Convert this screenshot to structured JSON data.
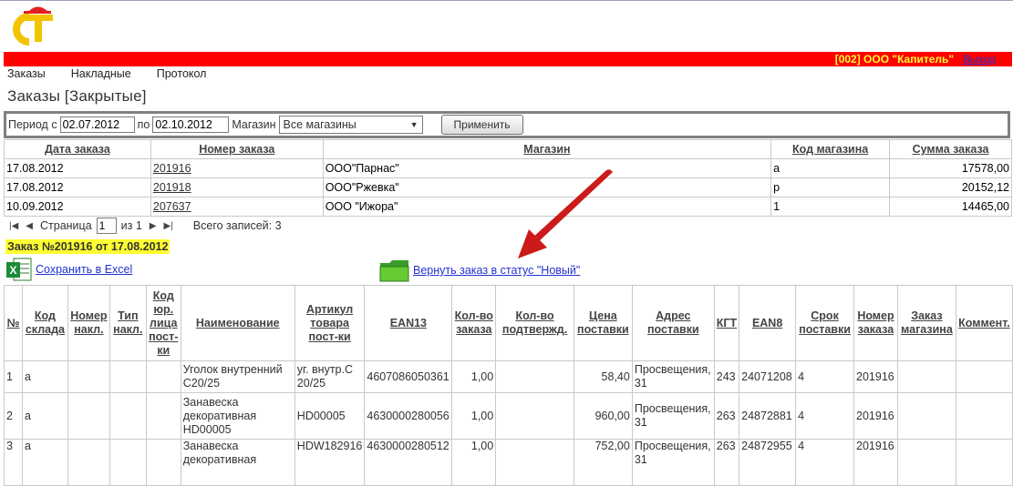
{
  "header": {
    "company": "[002] ООО \"Капитель\"",
    "logout": "Выход"
  },
  "nav": [
    "Заказы",
    "Накладные",
    "Протокол"
  ],
  "page_title": "Заказы [Закрытые]",
  "filter": {
    "period_from_label": "Период с",
    "date_from": "02.07.2012",
    "period_to_label": "по",
    "date_to": "02.10.2012",
    "store_label": "Магазин",
    "store_value": "Все магазины",
    "apply_label": "Применить"
  },
  "orders": {
    "columns": [
      "Дата заказа",
      "Номер заказа",
      "Магазин",
      "Код магазина",
      "Сумма заказа"
    ],
    "rows": [
      [
        "17.08.2012",
        "201916",
        "ООО\"Парнас\"",
        "а",
        "17578,00"
      ],
      [
        "17.08.2012",
        "201918",
        "ООО\"Ржевка\"",
        "р",
        "20152,12"
      ],
      [
        "10.09.2012",
        "207637",
        "ООО \"Ижора\"",
        "1",
        "14465,00"
      ]
    ]
  },
  "pager": {
    "page_label": "Страница",
    "page_value": "1",
    "of_label": "из 1",
    "total_label": "Всего записей: 3"
  },
  "order_detail": {
    "title": "Заказ №201916 от 17.08.2012",
    "excel_link": "Сохранить в Excel",
    "reopen_link": "Вернуть заказ в статус \"Новый\"",
    "columns": [
      "№",
      "Код склада",
      "Номер накл.",
      "Тип накл.",
      "Код юр. лица пост-ки",
      "Наименование",
      "Артикул товара пост-ки",
      "EAN13",
      "Кол-во заказа",
      "Кол-во подтвержд.",
      "Цена поставки",
      "Адрес поставки",
      "КГТ",
      "EAN8",
      "Срок поставки",
      "Номер заказа",
      "Заказ магазина",
      "Коммент."
    ],
    "rows": [
      [
        "1",
        "а",
        "",
        "",
        "",
        "Уголок внутренний С20/25",
        "уг. внутр.С 20/25",
        "4607086050361",
        "1,00",
        "",
        "58,40",
        "Просвещения, 31",
        "243",
        "24071208",
        "4",
        "201916",
        "",
        ""
      ],
      [
        "2",
        "а",
        "",
        "",
        "",
        "Занавеска декоративная HD00005",
        "HD00005",
        "4630000280056",
        "1,00",
        "",
        "960,00",
        "Просвещения, 31",
        "263",
        "24872881",
        "4",
        "201916",
        "",
        ""
      ],
      [
        "3",
        "а",
        "",
        "",
        "",
        "Занавеска декоративная",
        "HDW182916",
        "4630000280512",
        "1,00",
        "",
        "752,00",
        "Просвещения, 31",
        "263",
        "24872955",
        "4",
        "201916",
        "",
        ""
      ]
    ]
  },
  "colors": {
    "header_bar": "#ff0000",
    "company_text": "#ffff33",
    "highlight": "#ffff33",
    "arrow": "#cc1a1a"
  },
  "icons": {
    "logo": "ct-logo-icon",
    "excel": "excel-icon",
    "folder": "green-folder-icon",
    "dropdown": "chevron-down-icon"
  }
}
